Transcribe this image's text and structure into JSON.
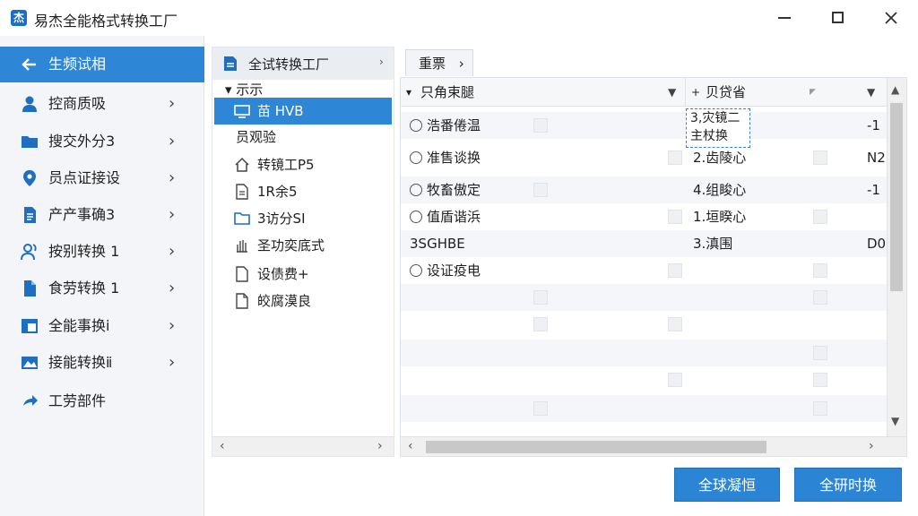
{
  "window": {
    "title": "易杰全能格式转换工厂",
    "app_icon_glyph": "杰"
  },
  "sidebar": {
    "items": [
      {
        "label": "生频试相",
        "icon": "back-arrow-icon",
        "active": true
      },
      {
        "label": "控商质吸",
        "icon": "user-icon"
      },
      {
        "label": "搜交外分3",
        "icon": "folder-icon"
      },
      {
        "label": "员点证接设",
        "icon": "location-pin-icon"
      },
      {
        "label": "产产事确3",
        "icon": "document-icon"
      },
      {
        "label": "按别转换 1",
        "icon": "people-icon"
      },
      {
        "label": "食劳转换 1",
        "icon": "file-icon"
      },
      {
        "label": "全能事换ⅰ",
        "icon": "layout-icon"
      },
      {
        "label": "接能转换ⅱ",
        "icon": "image-icon"
      },
      {
        "label": "工劳部件",
        "icon": "share-icon"
      }
    ],
    "chevron": "›"
  },
  "tree": {
    "header": "全试转换工厂",
    "root": "▾ 示示",
    "items": [
      {
        "label": "苗 HVB",
        "icon": "monitor-icon",
        "selected": true
      },
      {
        "label": "员观验",
        "icon": ""
      },
      {
        "label": "转镜工P5",
        "icon": "home-icon"
      },
      {
        "label": "1R余5",
        "icon": "document-icon"
      },
      {
        "label": "3访分SI",
        "icon": "folder-icon"
      },
      {
        "label": "圣功奕底式",
        "icon": "hand-icon"
      },
      {
        "label": "设债费+",
        "icon": "file-icon"
      },
      {
        "label": "皎腐漠良",
        "icon": "file-icon"
      }
    ]
  },
  "breadcrumb": {
    "label": "重票",
    "chevron": "›"
  },
  "list": {
    "headers": {
      "name": "只角束腿",
      "detail": "贝贷省"
    },
    "sort_marks": {
      "name": "▾",
      "detail": "+"
    },
    "rows": [
      {
        "name": "浩番倦温",
        "radio": true,
        "detail": "3,灾镜二\n主杖换",
        "code": "-1",
        "editing": true
      },
      {
        "name": "准售谈换",
        "radio": true,
        "detail": "2.齿陵心",
        "code": "N2"
      },
      {
        "name": "牧畜傲定",
        "radio": true,
        "detail": "4.组睃心",
        "code": "-1"
      },
      {
        "name": "值盾谐浜",
        "radio": true,
        "detail": "1.垣睽心",
        "code": ""
      },
      {
        "name": "3SGHBE",
        "radio": false,
        "detail": "3.滇围",
        "code": "D0"
      },
      {
        "name": "设证疫电",
        "radio": true,
        "detail": "",
        "code": ""
      }
    ]
  },
  "buttons": {
    "left": "全球凝恒",
    "right": "全研时换"
  }
}
